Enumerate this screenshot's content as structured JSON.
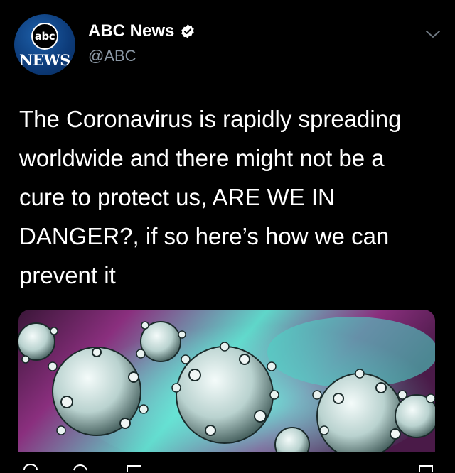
{
  "account": {
    "display_name": "ABC News",
    "handle": "@ABC",
    "verified": true,
    "avatar": {
      "logo_text": "abc",
      "sub_text": "NEWS"
    }
  },
  "tweet": {
    "text": "The Coronavirus is rapidly spreading\nworldwide and there might not be a\ncure to protect us, ARE WE IN\nDANGER?, if so here’s how we can\nprevent it"
  },
  "media": {
    "description_icon": "coronavirus-image",
    "colors": {
      "background_magenta": "#8a2f7e",
      "background_teal": "#3fd3c6",
      "virus_body": "#e8f2f0"
    }
  },
  "icons": {
    "verified": "verified-badge-icon",
    "menu": "chevron-down-icon",
    "reply": "reply-icon",
    "retweet": "retweet-icon",
    "like": "like-icon",
    "share": "share-icon"
  },
  "colors": {
    "background": "#000000",
    "text_primary": "#ffffff",
    "text_secondary": "#8b98a5",
    "avatar_blue": "#0c3a78"
  }
}
